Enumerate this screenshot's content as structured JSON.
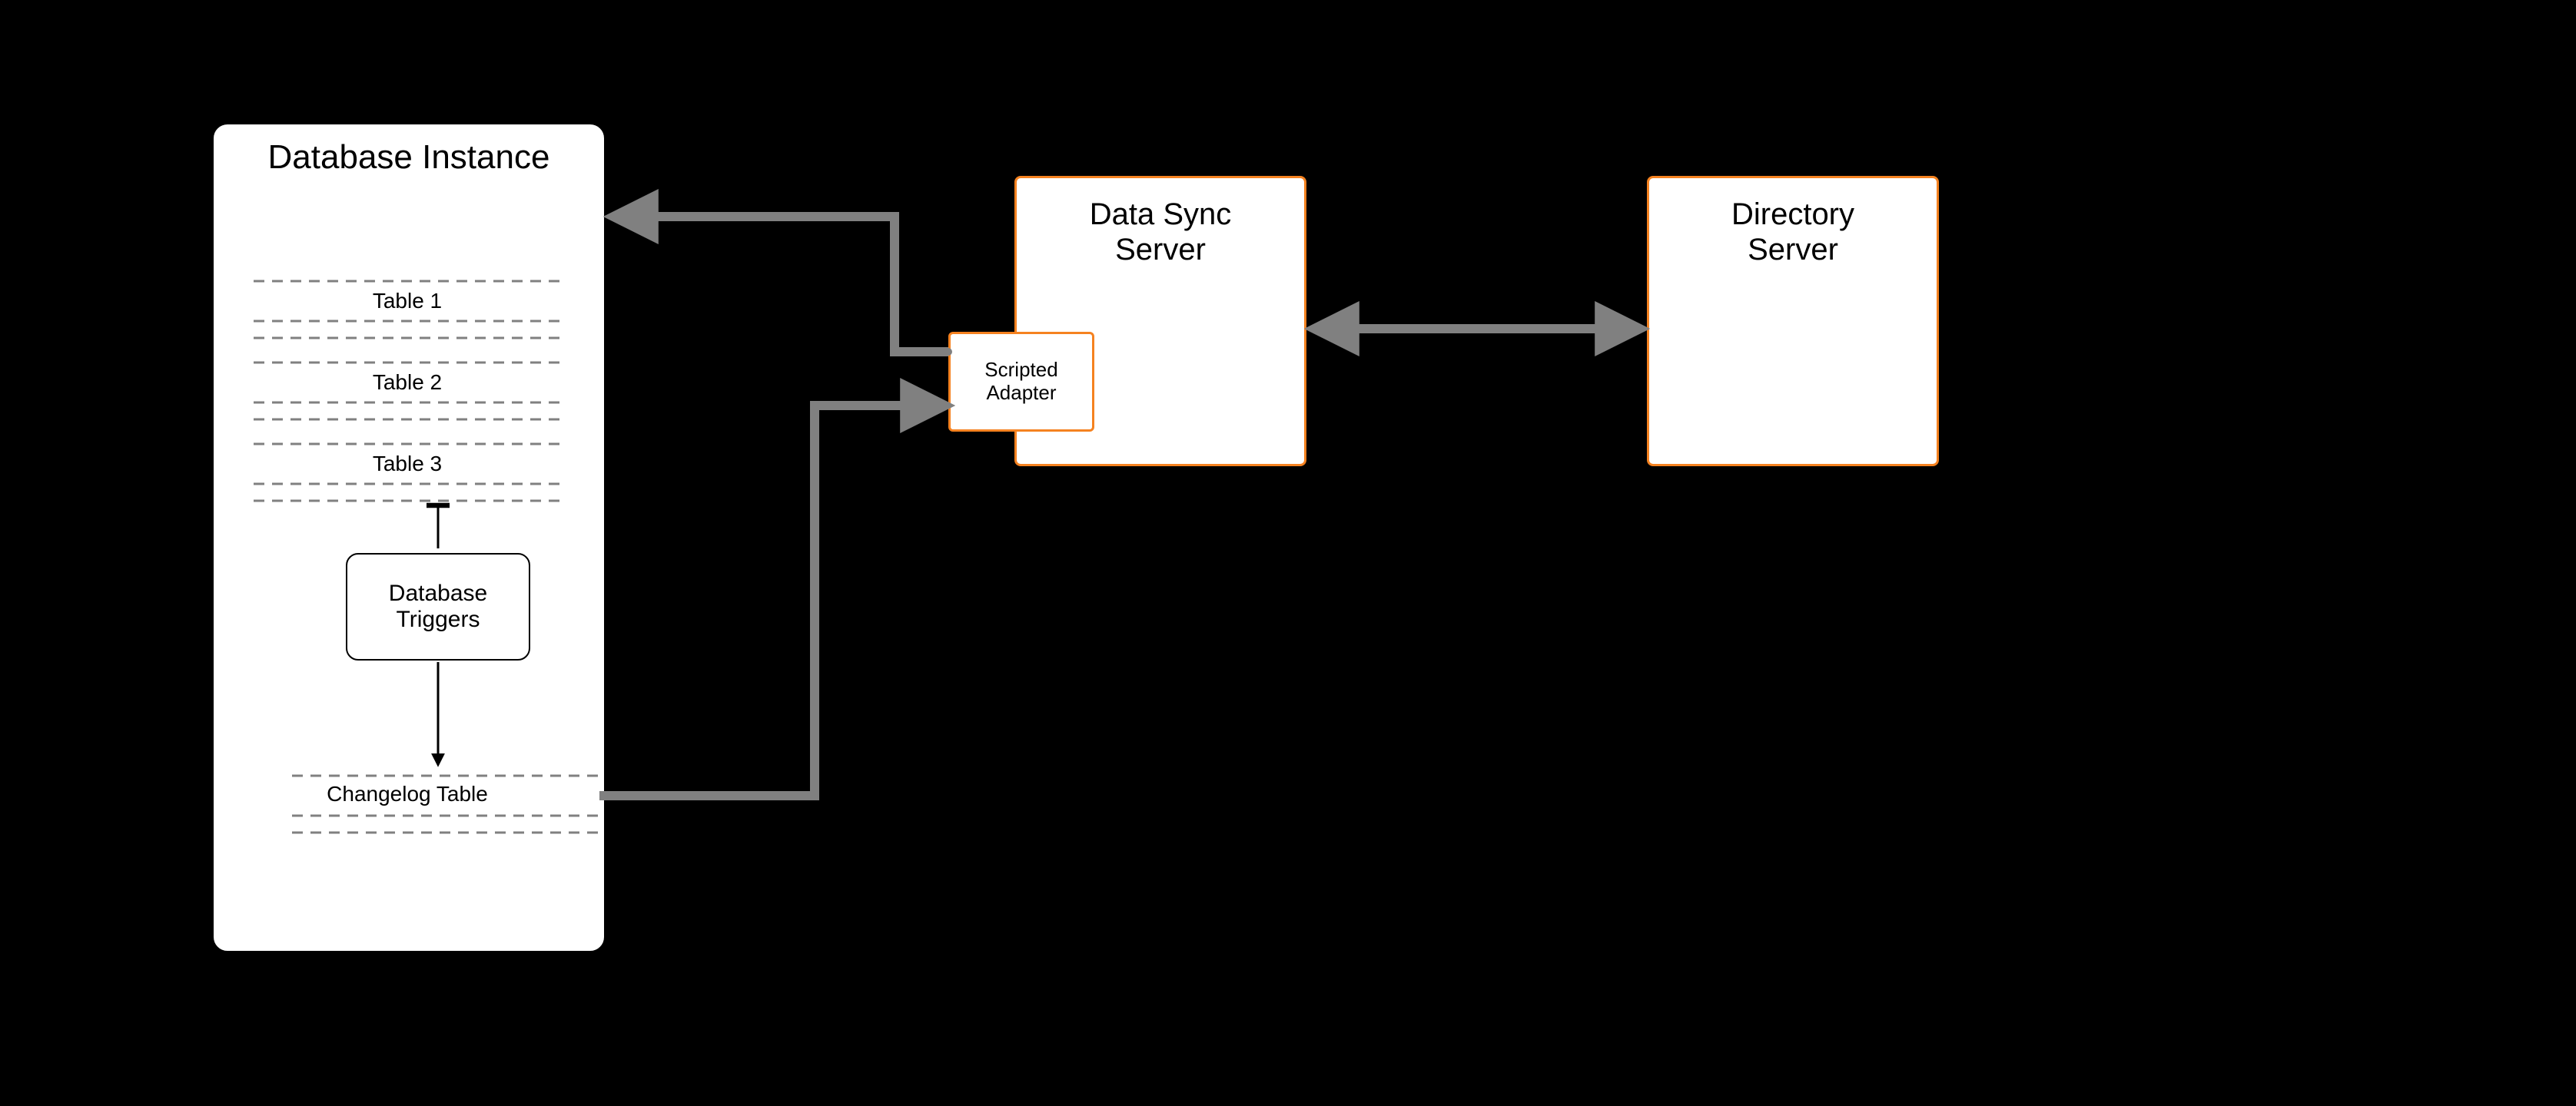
{
  "databaseInstance": {
    "title": "Database Instance",
    "tables": [
      "Table 1",
      "Table 2",
      "Table 3"
    ],
    "triggersLabel": "Database\nTriggers",
    "changelogLabel": "Changelog Table"
  },
  "dataSyncServer": {
    "title": "Data Sync\nServer",
    "adapterLabel": "Scripted\nAdapter"
  },
  "directoryServer": {
    "title": "Directory\nServer"
  }
}
